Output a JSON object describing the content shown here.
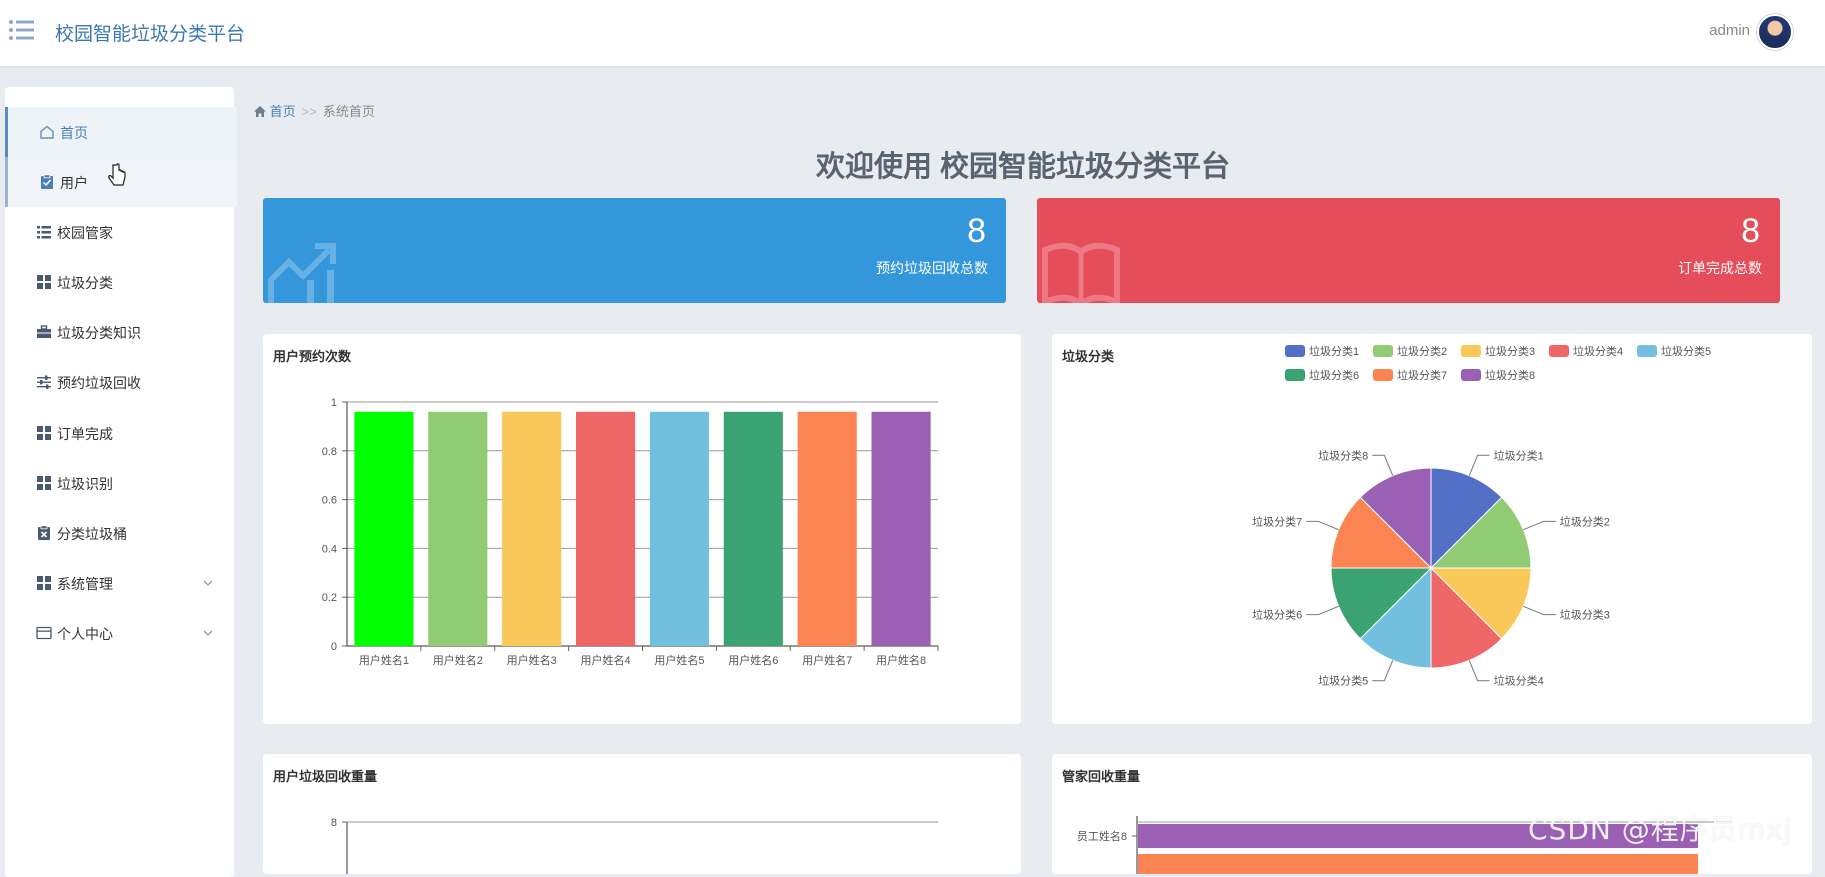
{
  "header": {
    "app_title": "校园智能垃圾分类平台",
    "user_name": "admin"
  },
  "sidebar": {
    "items": [
      {
        "label": "首页",
        "icon": "home-icon"
      },
      {
        "label": "用户",
        "icon": "clipboard-check-icon"
      },
      {
        "label": "校园管家",
        "icon": "list-icon"
      },
      {
        "label": "垃圾分类",
        "icon": "grid-icon"
      },
      {
        "label": "垃圾分类知识",
        "icon": "briefcase-icon"
      },
      {
        "label": "预约垃圾回收",
        "icon": "sliders-icon"
      },
      {
        "label": "订单完成",
        "icon": "grid-icon"
      },
      {
        "label": "垃圾识别",
        "icon": "grid-icon"
      },
      {
        "label": "分类垃圾桶",
        "icon": "clipboard-x-icon"
      },
      {
        "label": "系统管理",
        "icon": "grid-icon"
      },
      {
        "label": "个人中心",
        "icon": "card-icon"
      }
    ]
  },
  "breadcrumb": {
    "home": "首页",
    "separator": ">>",
    "current": "系统首页"
  },
  "welcome": "欢迎使用 校园智能垃圾分类平台",
  "stats": [
    {
      "value": "8",
      "label": "预约垃圾回收总数",
      "color": "#3497db",
      "icon": "chart-up-icon"
    },
    {
      "value": "8",
      "label": "订单完成总数",
      "color": "#e64d5a",
      "icon": "book-icon"
    }
  ],
  "cards": {
    "bar_title": "用户预约次数",
    "pie_title": "垃圾分类",
    "line_title": "用户垃圾回收重量",
    "hbar_title": "管家回收重量"
  },
  "chart_data": [
    {
      "type": "bar",
      "title": "用户预约次数",
      "categories": [
        "用户姓名1",
        "用户姓名2",
        "用户姓名3",
        "用户姓名4",
        "用户姓名5",
        "用户姓名6",
        "用户姓名7",
        "用户姓名8"
      ],
      "values": [
        1,
        1,
        1,
        1,
        1,
        1,
        1,
        1
      ],
      "yticks": [
        "0",
        "0.2",
        "0.4",
        "0.6",
        "0.8",
        "1"
      ],
      "ylim": [
        0,
        1
      ],
      "grid": true,
      "colors": [
        "#00ff00",
        "#91cb74",
        "#fac858",
        "#ee6666",
        "#73c0de",
        "#3ba272",
        "#fc8452",
        "#9a60b4"
      ]
    },
    {
      "type": "pie",
      "title": "垃圾分类",
      "labels": [
        "垃圾分类1",
        "垃圾分类2",
        "垃圾分类3",
        "垃圾分类4",
        "垃圾分类5",
        "垃圾分类6",
        "垃圾分类7",
        "垃圾分类8"
      ],
      "values": [
        1,
        1,
        1,
        1,
        1,
        1,
        1,
        1
      ],
      "radii": [
        100,
        100,
        100,
        100,
        100,
        100,
        100,
        100
      ],
      "legend_position": "top-right",
      "colors": [
        "#5470c6",
        "#91cb74",
        "#fac858",
        "#ee6666",
        "#73c0de",
        "#3ba272",
        "#fc8452",
        "#9a60b4"
      ]
    },
    {
      "type": "line",
      "title": "用户垃圾回收重量",
      "yticks": [
        "8"
      ]
    },
    {
      "type": "bar",
      "title": "管家回收重量",
      "orientation": "horizontal",
      "categories": [
        "员工姓名8"
      ],
      "colors": [
        "#9a60b4",
        "#fc8452"
      ]
    }
  ],
  "watermark": "CSDN @程序员mxj"
}
